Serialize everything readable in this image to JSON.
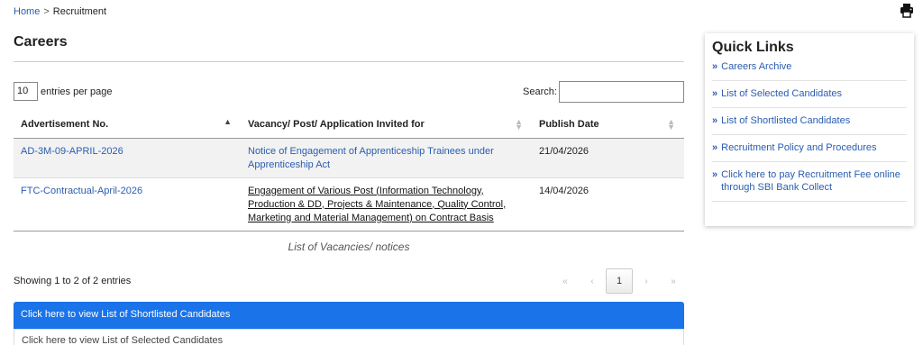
{
  "breadcrumb": {
    "home": "Home",
    "separator": ">",
    "current": "Recruitment"
  },
  "print_icon": "printer-icon",
  "page_title": "Careers",
  "table_controls": {
    "length_value": "10",
    "length_label": "entries per page",
    "search_label": "Search:",
    "search_value": ""
  },
  "table": {
    "headers": [
      "Advertisement No.",
      "Vacancy/ Post/ Application Invited for",
      "Publish Date"
    ],
    "rows": [
      {
        "adv_no": "AD-3M-09-APRIL-2026",
        "vacancy": "Notice of Engagement of Apprenticeship Trainees under Apprenticeship Act",
        "date": "21/04/2026"
      },
      {
        "adv_no": "FTC-Contractual-April-2026",
        "vacancy": "Engagement of Various Post (Information Technology, Production & DD, Projects & Maintenance, Quality Control, Marketing and Material Management) on Contract Basis",
        "date": "14/04/2026"
      }
    ],
    "caption": "List of Vacancies/ notices"
  },
  "info": "Showing 1 to 2 of 2 entries",
  "pagination": {
    "first": "«",
    "prev": "‹",
    "current": "1",
    "next": "›",
    "last": "»"
  },
  "actions": {
    "shortlisted": "Click here to view List of Shortlisted Candidates",
    "selected": "Click here to view List of Selected Candidates"
  },
  "quick_links": {
    "title": "Quick Links",
    "items": [
      "Careers Archive",
      "List of Selected Candidates",
      "List of Shortlisted Candidates",
      "Recruitment Policy and Procedures",
      "Click here to pay Recruitment Fee online through SBI Bank Collect"
    ]
  },
  "colors": {
    "link": "#2a5db0",
    "primary_button": "#1a73e8"
  }
}
